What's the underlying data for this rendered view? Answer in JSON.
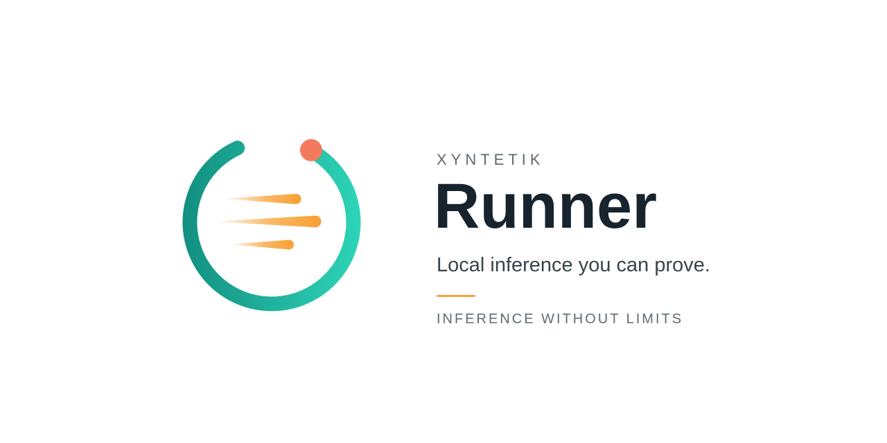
{
  "brand": {
    "company": "XYNTETIK",
    "product": "Runner",
    "tagline": "Local inference you can prove.",
    "slogan": "INFERENCE WITHOUT LIMITS"
  },
  "logo": {
    "icon": "runner-ring-logo",
    "ring_color_start": "#128f80",
    "ring_color_end": "#2dd4b8",
    "dot_color": "#f47a5e",
    "streak_color": "#f8a033"
  },
  "colors": {
    "accent": "#f7a33a",
    "heading": "#17242d",
    "muted": "#5f6b72"
  }
}
